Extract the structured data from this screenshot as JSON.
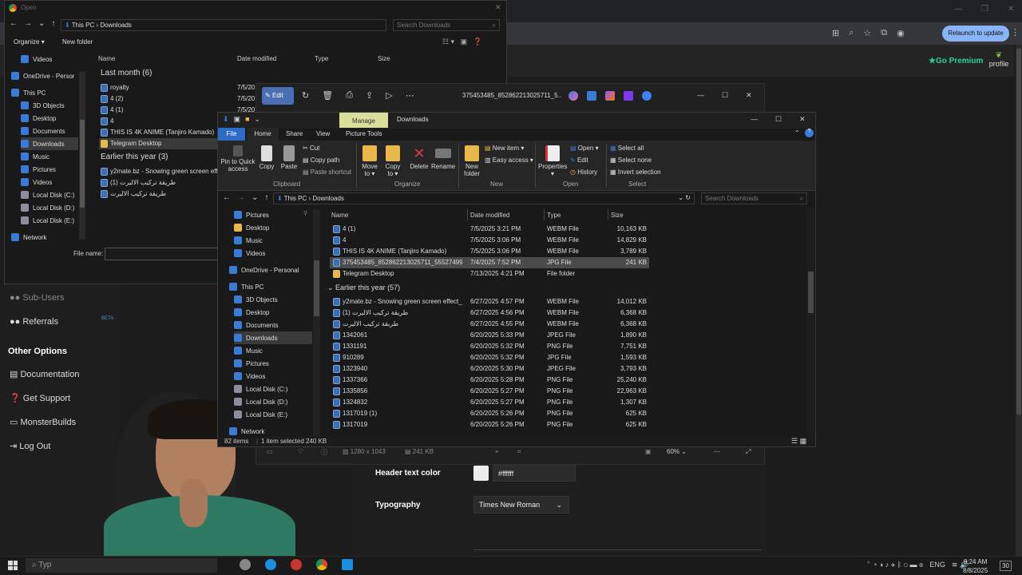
{
  "browser": {
    "relaunch_label": "Relaunch to update",
    "go_premium": "Go Premium",
    "profile": "profile"
  },
  "open_dialog": {
    "title": "Open",
    "path": [
      "This PC",
      "Downloads"
    ],
    "search_placeholder": "Search Downloads",
    "organize": "Organize",
    "new_folder": "New folder",
    "columns": [
      "Name",
      "Date modified",
      "Type",
      "Size"
    ],
    "groups": [
      {
        "label": "Last month (6)",
        "items": [
          {
            "name": "royalty",
            "date": "7/5/20",
            "icon": "file"
          },
          {
            "name": "4 (2)",
            "date": "7/5/20",
            "icon": "file"
          },
          {
            "name": "4 (1)",
            "date": "7/5/20",
            "icon": "file"
          },
          {
            "name": "4",
            "date": "",
            "icon": "file"
          },
          {
            "name": "THIS IS 4K ANIME (Tanjiro Kamado)",
            "date": "",
            "icon": "file"
          },
          {
            "name": "Telegram Desktop",
            "date": "",
            "icon": "folder"
          }
        ]
      },
      {
        "label": "Earlier this year (3)",
        "items": [
          {
            "name": "y2mate.bz - Snowing green screen effe",
            "date": "",
            "icon": "file"
          },
          {
            "name": "طريقة تركيب الاليرت (1)",
            "date": "",
            "icon": "file"
          },
          {
            "name": "طريقة تركيب الاليرت",
            "date": "",
            "icon": "file"
          }
        ]
      }
    ],
    "nav": [
      "Videos",
      "OneDrive - Persor",
      "This PC",
      "3D Objects",
      "Desktop",
      "Documents",
      "Downloads",
      "Music",
      "Pictures",
      "Videos",
      "Local Disk (C:)",
      "Local Disk (D:)",
      "Local Disk (E:)",
      "Network"
    ],
    "file_name_label": "File name:"
  },
  "photo_viewer": {
    "edit": "Edit",
    "filename": "375453485_852862213025711_5...",
    "dims": "1280 x 1043",
    "size": "241 KB",
    "zoom": "60%"
  },
  "explorer": {
    "title": "Downloads",
    "manage_tab": "Manage",
    "tabs": [
      "File",
      "Home",
      "Share",
      "View",
      "Picture Tools"
    ],
    "clipboard": {
      "pin": "Pin to Quick access",
      "copy": "Copy",
      "paste": "Paste",
      "cut": "Cut",
      "copy_path": "Copy path",
      "paste_shortcut": "Paste shortcut",
      "group": "Clipboard"
    },
    "organize": {
      "move_to": "Move to",
      "copy_to": "Copy to",
      "delete": "Delete",
      "rename": "Rename",
      "group": "Organize"
    },
    "new": {
      "new_folder": "New folder",
      "new_item": "New item",
      "easy_access": "Easy access",
      "group": "New"
    },
    "open": {
      "properties": "Properties",
      "open": "Open",
      "edit": "Edit",
      "history": "History",
      "group": "Open"
    },
    "select": {
      "select_all": "Select all",
      "select_none": "Select none",
      "invert": "Invert selection",
      "group": "Select"
    },
    "path": [
      "This PC",
      "Downloads"
    ],
    "search_placeholder": "Search Downloads",
    "columns": [
      "Name",
      "Date modified",
      "Type",
      "Size"
    ],
    "nav": [
      "Pictures",
      "Desktop",
      "Music",
      "Videos",
      "OneDrive - Personal",
      "This PC",
      "3D Objects",
      "Desktop",
      "Documents",
      "Downloads",
      "Music",
      "Pictures",
      "Videos",
      "Local Disk (C:)",
      "Local Disk (D:)",
      "Local Disk (E:)",
      "Network"
    ],
    "rows_top": [
      {
        "name": "4 (1)",
        "date": "7/5/2025 3:21 PM",
        "type": "WEBM File",
        "size": "10,163 KB",
        "icon": "file"
      },
      {
        "name": "4",
        "date": "7/5/2025 3:06 PM",
        "type": "WEBM File",
        "size": "14,829 KB",
        "icon": "file"
      },
      {
        "name": "THIS IS 4K ANIME (Tanjiro Kamado)",
        "date": "7/5/2025 3:06 PM",
        "type": "WEBM File",
        "size": "3,789 KB",
        "icon": "file"
      },
      {
        "name": "375453485_852862213025711_5552749934...",
        "date": "7/4/2025 7:52 PM",
        "type": "JPG File",
        "size": "241 KB",
        "icon": "file"
      },
      {
        "name": "Telegram Desktop",
        "date": "7/13/2025 4:21 PM",
        "type": "File folder",
        "size": "",
        "icon": "folder"
      }
    ],
    "group2": "Earlier this year (57)",
    "rows_bottom": [
      {
        "name": "y2mate.bz - Snowing green screen effect_1",
        "date": "6/27/2025 4:57 PM",
        "type": "WEBM File",
        "size": "14,012 KB",
        "icon": "file"
      },
      {
        "name": "طريقة تركيب الاليرت (1)",
        "date": "6/27/2025 4:56 PM",
        "type": "WEBM File",
        "size": "6,368 KB",
        "icon": "file"
      },
      {
        "name": "طريقة تركيب الاليرت",
        "date": "6/27/2025 4:55 PM",
        "type": "WEBM File",
        "size": "6,368 KB",
        "icon": "file"
      },
      {
        "name": "1342061",
        "date": "6/20/2025 5:33 PM",
        "type": "JPEG File",
        "size": "1,890 KB",
        "icon": "file"
      },
      {
        "name": "1331191",
        "date": "6/20/2025 5:32 PM",
        "type": "PNG File",
        "size": "7,751 KB",
        "icon": "file"
      },
      {
        "name": "910289",
        "date": "6/20/2025 5:32 PM",
        "type": "JPG File",
        "size": "1,593 KB",
        "icon": "file"
      },
      {
        "name": "1323940",
        "date": "6/20/2025 5:30 PM",
        "type": "JPEG File",
        "size": "3,793 KB",
        "icon": "file"
      },
      {
        "name": "1337366",
        "date": "6/20/2025 5:28 PM",
        "type": "PNG File",
        "size": "25,240 KB",
        "icon": "file"
      },
      {
        "name": "1335856",
        "date": "6/20/2025 5:27 PM",
        "type": "PNG File",
        "size": "22,963 KB",
        "icon": "file"
      },
      {
        "name": "1324832",
        "date": "6/20/2025 5:27 PM",
        "type": "PNG File",
        "size": "1,307 KB",
        "icon": "file"
      },
      {
        "name": "1317019 (1)",
        "date": "6/20/2025 5:26 PM",
        "type": "PNG File",
        "size": "625 KB",
        "icon": "file"
      },
      {
        "name": "1317019",
        "date": "6/20/2025 5:26 PM",
        "type": "PNG File",
        "size": "625 KB",
        "icon": "file"
      }
    ],
    "status": {
      "count": "82 items",
      "selected": "1 item selected  240 KB"
    }
  },
  "app_sidebar": {
    "sub_users": "Sub-Users",
    "referrals": "Referrals",
    "beta": "BETA",
    "other_options": "Other Options",
    "documentation": "Documentation",
    "get_support": "Get Support",
    "monsterbuilds": "MonsterBuilds",
    "log_out": "Log Out"
  },
  "settings": {
    "header_text_color_label": "Header text color",
    "header_text_color_value": "#ffffff",
    "typography_label": "Typography",
    "typography_value": "Times New Roman"
  },
  "taskbar": {
    "search": "Typ",
    "lang": "ENG",
    "time": "8:24 AM",
    "date": "8/8/2025",
    "notif": "30"
  }
}
